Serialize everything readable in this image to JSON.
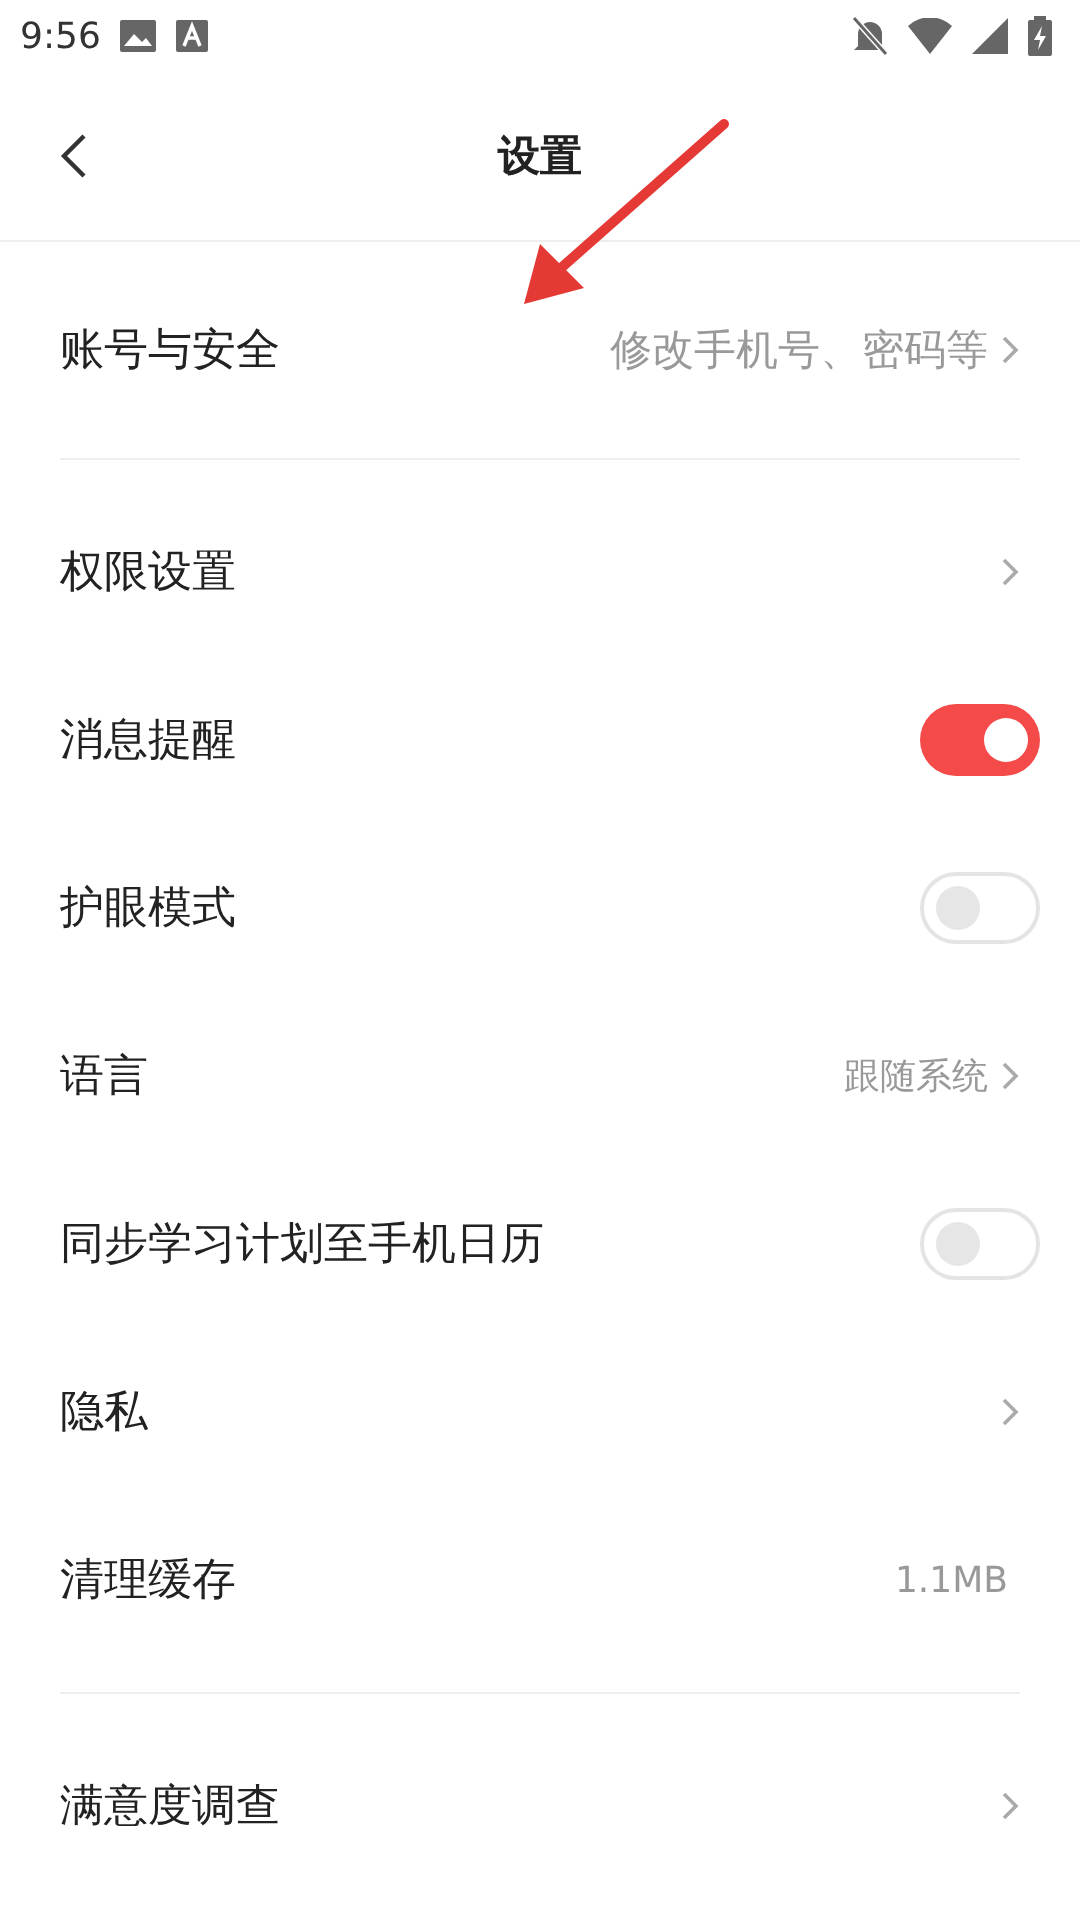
{
  "status_bar": {
    "time": "9:56"
  },
  "header": {
    "title": "设置"
  },
  "sections": [
    [
      {
        "kind": "link",
        "label": "账号与安全",
        "value": "修改手机号、密码等"
      }
    ],
    [
      {
        "kind": "link",
        "label": "权限设置"
      },
      {
        "kind": "toggle",
        "label": "消息提醒",
        "on": true
      },
      {
        "kind": "toggle",
        "label": "护眼模式",
        "on": false
      },
      {
        "kind": "link",
        "label": "语言",
        "value": "跟随系统"
      },
      {
        "kind": "toggle",
        "label": "同步学习计划至手机日历",
        "on": false
      },
      {
        "kind": "link",
        "label": "隐私"
      },
      {
        "kind": "value",
        "label": "清理缓存",
        "value": "1.1MB"
      }
    ],
    [
      {
        "kind": "link",
        "label": "满意度调查"
      }
    ]
  ]
}
